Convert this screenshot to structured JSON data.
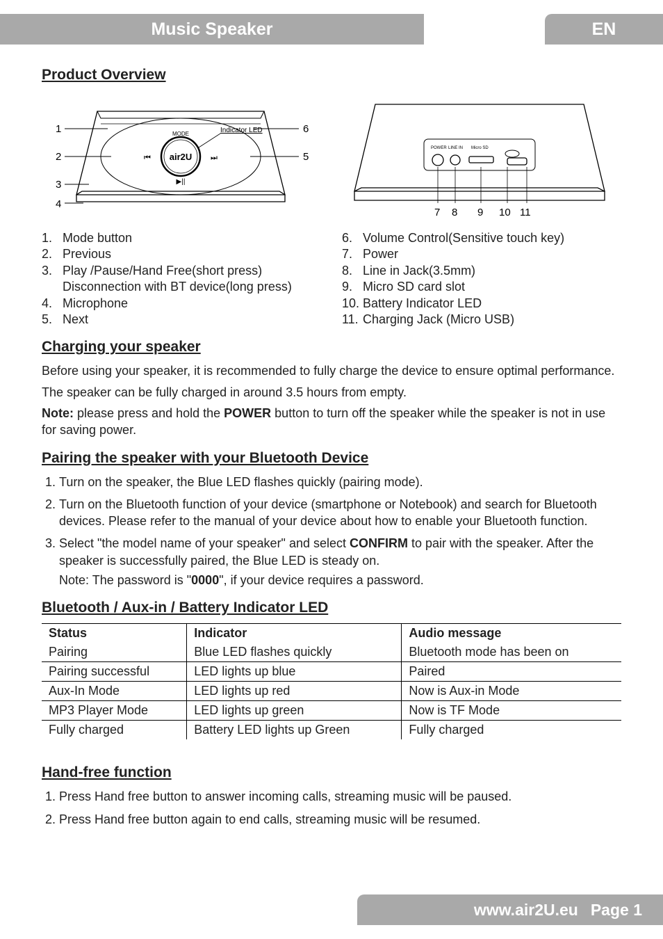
{
  "header": {
    "title": "Music Speaker",
    "lang": "EN"
  },
  "sections": {
    "overview": {
      "heading": "Product Overview"
    },
    "charging": {
      "heading": "Charging your speaker",
      "p1": "Before using your speaker, it is recommended to fully charge the device to ensure optimal performance.",
      "p2": "The speaker can be fully charged in around 3.5 hours from empty.",
      "p3_pre": "Note:",
      "p3_mid": " please press and hold the ",
      "p3_bold": "POWER",
      "p3_post": " button to turn off the speaker while the speaker is not in use for saving power."
    },
    "pairing": {
      "heading": "Pairing the speaker with your Bluetooth Device",
      "items": [
        "Turn on the speaker, the Blue LED flashes quickly (pairing mode).",
        "Turn on the Bluetooth function of your device (smartphone or Notebook) and search for Bluetooth devices. Please refer to the manual of your device about how to enable your Bluetooth function."
      ],
      "item3_pre": "Select \"the model name of your speaker\" and select ",
      "item3_bold": "CONFIRM",
      "item3_post": " to pair with the speaker. After the speaker is successfully paired, the Blue LED is steady on.",
      "note_pre": "Note:  The password is \"",
      "note_bold": "0000",
      "note_post": "\", if your device requires a password."
    },
    "led": {
      "heading": "Bluetooth / Aux-in / Battery Indicator LED",
      "headers": [
        "Status",
        "Indicator",
        "Audio message"
      ],
      "rows": [
        [
          "Pairing",
          "Blue LED flashes quickly",
          "Bluetooth mode has been on"
        ],
        [
          "Pairing successful",
          "LED lights up blue",
          "Paired"
        ],
        [
          "Aux-In Mode",
          "LED lights up red",
          "Now is Aux-in Mode"
        ],
        [
          "MP3 Player Mode",
          "LED lights up green",
          "Now is TF Mode"
        ],
        [
          "Fully charged",
          "Battery LED lights up Green",
          "Fully charged"
        ]
      ]
    },
    "handfree": {
      "heading": "Hand-free function",
      "items": [
        "Press Hand free button to answer incoming calls, streaming music will be paused.",
        "Press Hand free button again to end calls, streaming music will be resumed."
      ]
    }
  },
  "diagram": {
    "front_labels": {
      "mode": "MODE",
      "indicator_led": "Indicator LED",
      "brand": "air2U",
      "callouts_left": [
        "1",
        "2",
        "3",
        "4"
      ],
      "callouts_right": [
        "6",
        "5"
      ]
    },
    "rear_labels": {
      "power": "POWER",
      "linein": "LINE IN",
      "microsd": "Micro SD",
      "callouts": [
        "7",
        "8",
        "9",
        "10",
        "11"
      ]
    }
  },
  "parts_left": [
    {
      "n": "1.",
      "t": "Mode button"
    },
    {
      "n": "2.",
      "t": "Previous"
    },
    {
      "n": "3.",
      "t": "Play /Pause/Hand Free(short press)"
    },
    {
      "n": "",
      "t": "Disconnection with BT device(long press)"
    },
    {
      "n": "4.",
      "t": "Microphone"
    },
    {
      "n": "5.",
      "t": "Next"
    }
  ],
  "parts_right": [
    {
      "n": "6.",
      "t": "Volume Control(Sensitive touch key)"
    },
    {
      "n": "7.",
      "t": "Power"
    },
    {
      "n": "8.",
      "t": "Line in Jack(3.5mm)"
    },
    {
      "n": "9.",
      "t": "Micro SD card slot"
    },
    {
      "n": "10.",
      "t": "Battery Indicator LED"
    },
    {
      "n": "11.",
      "t": "Charging Jack (Micro USB)"
    }
  ],
  "footer": {
    "site": "www.air2U.eu",
    "page": "Page 1"
  }
}
